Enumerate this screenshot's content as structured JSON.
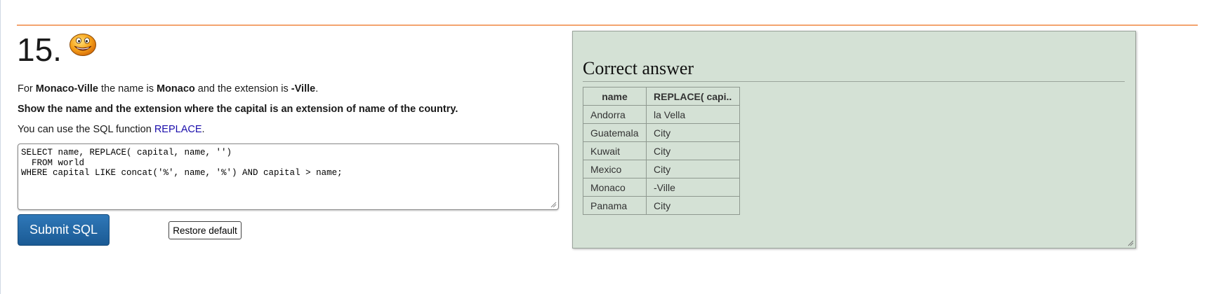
{
  "question": {
    "number": "15.",
    "icon": "smiley-face-icon",
    "line1": {
      "t1": "For ",
      "b1": "Monaco-Ville",
      "t2": " the name is ",
      "b2": "Monaco",
      "t3": " and the extension is ",
      "b3": "-Ville",
      "t4": "."
    },
    "line2": "Show the name and the extension where the capital is an extension of name of the country.",
    "line3": {
      "prefix": "You can use the SQL function ",
      "link": "REPLACE",
      "suffix": "."
    }
  },
  "editor": {
    "sql": "SELECT name, REPLACE( capital, name, '')\n  FROM world\nWHERE capital LIKE concat('%', name, '%') AND capital > name;"
  },
  "buttons": {
    "submit_label": "Submit SQL",
    "restore_label": "Restore default"
  },
  "answer": {
    "title": "Correct answer",
    "columns": [
      "name",
      "REPLACE( capi.."
    ],
    "rows": [
      [
        "Andorra",
        "la Vella"
      ],
      [
        "Guatemala",
        "City"
      ],
      [
        "Kuwait",
        "City"
      ],
      [
        "Mexico",
        "City"
      ],
      [
        "Monaco",
        "-Ville"
      ],
      [
        "Panama",
        "City"
      ]
    ]
  },
  "colors": {
    "rule": "#f3a46f",
    "panel_bg": "#d4e1d5",
    "submit_bg": "#2468a8",
    "link": "#1a0dab"
  }
}
